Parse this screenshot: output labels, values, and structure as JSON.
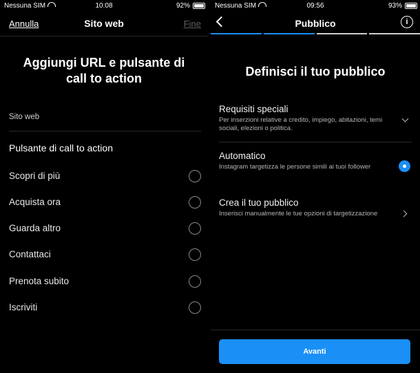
{
  "left": {
    "status": {
      "carrier": "Nessuna SIM",
      "time": "10:08",
      "battery": "92%"
    },
    "nav": {
      "cancel": "Annulla",
      "title": "Sito web",
      "done": "Fine"
    },
    "heading": "Aggiungi URL e pulsante di call to action",
    "website_label": "Sito web",
    "cta_title": "Pulsante di call to action",
    "options": [
      "Scopri di più",
      "Acquista ora",
      "Guarda altro",
      "Contattaci",
      "Prenota subito",
      "Iscriviti"
    ]
  },
  "right": {
    "status": {
      "carrier": "Nessuna SIM",
      "time": "09:56",
      "battery": "93%"
    },
    "nav": {
      "title": "Pubblico"
    },
    "progress_segments": 4,
    "progress_active": 2,
    "accent": "#1a8ff5",
    "heading": "Definisci il tuo pubblico",
    "items": [
      {
        "title": "Requisiti speciali",
        "desc": "Per inserzioni relative a credito, impiego, abitazioni, temi sociali, elezioni o politica."
      },
      {
        "title": "Automatico",
        "desc": "Instagram targetizza le persone simili ai tuoi follower"
      },
      {
        "title": "Crea il tuo pubblico",
        "desc": "Inserisci manualmente le tue opzioni di targetizzazione"
      }
    ],
    "button": "Avanti"
  }
}
